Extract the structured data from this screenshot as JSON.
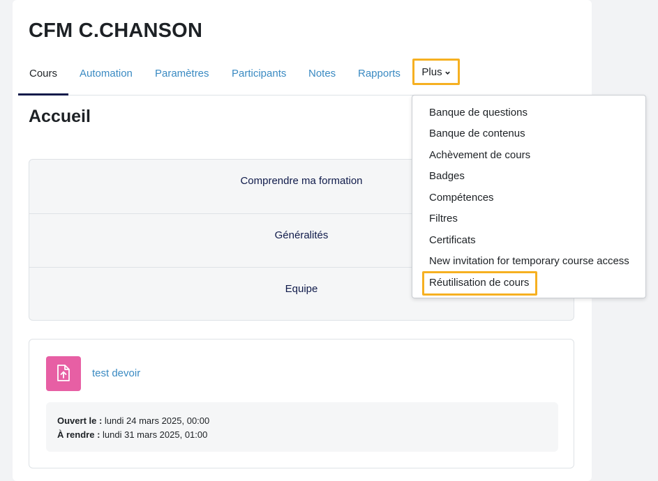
{
  "course": {
    "title": "CFM C.CHANSON"
  },
  "nav": {
    "items": [
      {
        "label": "Cours",
        "active": true
      },
      {
        "label": "Automation"
      },
      {
        "label": "Paramètres"
      },
      {
        "label": "Participants"
      },
      {
        "label": "Notes"
      },
      {
        "label": "Rapports"
      }
    ],
    "more_label": "Plus",
    "more_icon": "chevron-down-icon"
  },
  "main": {
    "section_title": "Accueil",
    "sections": [
      "Comprendre ma formation",
      "Généralités",
      "Equipe"
    ],
    "activity": {
      "icon": "assignment-upload-icon",
      "name": "test devoir",
      "opened_label": "Ouvert le :",
      "opened_value": "lundi 24 mars 2025, 00:00",
      "due_label": "À rendre :",
      "due_value": "lundi 31 mars 2025, 01:00"
    }
  },
  "dropdown": {
    "items": [
      "Banque de questions",
      "Banque de contenus",
      "Achèvement de cours",
      "Badges",
      "Compétences",
      "Filtres",
      "Certificats",
      "New invitation for temporary course access",
      "Réutilisation de cours"
    ]
  },
  "colors": {
    "highlight": "#f6b021",
    "link": "#3a8ac2",
    "activity_icon_bg": "#e75fa4",
    "active_tab_underline": "#0f1a4a"
  }
}
